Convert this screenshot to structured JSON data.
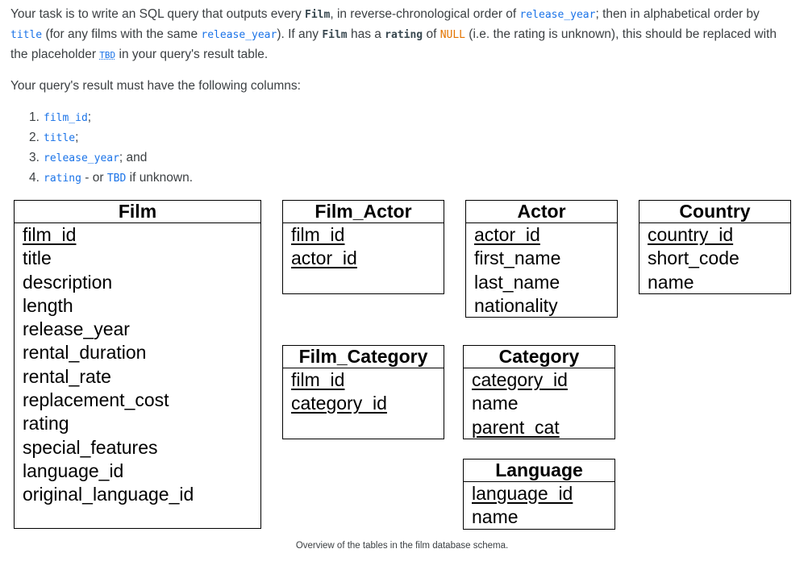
{
  "intro": {
    "t1": "Your task is to write an SQL query that outputs every ",
    "c1": "Film",
    "t2": ", in reverse-chronological order of ",
    "c2": "release_year",
    "t3": "; then in alphabetical order by ",
    "c3": "title",
    "t4": " (for any films with the same ",
    "c4": "release_year",
    "t5": "). If any ",
    "c5": "Film",
    "t6": " has a ",
    "c6": "rating",
    "t7": " of ",
    "c7": "NULL",
    "t8": " (i.e. the rating is unknown), this should be replaced with the placeholder ",
    "c8": "TBD",
    "t9": " in your query's result table."
  },
  "requirement": "Your query's result must have the following columns:",
  "columns": [
    {
      "num": "1.",
      "code": "film_id",
      "suffix": ";"
    },
    {
      "num": "2.",
      "code": "title",
      "suffix": ";"
    },
    {
      "num": "3.",
      "code": "release_year",
      "suffix": "; and"
    },
    {
      "num": "4.",
      "code": "rating",
      "mid": " - or ",
      "code2": "TBD",
      "suffix": " if unknown."
    }
  ],
  "tables": {
    "film": {
      "name": "Film",
      "fields": [
        "film_id",
        "title",
        "description",
        "length",
        "release_year",
        "rental_duration",
        "rental_rate",
        "replacement_cost",
        "rating",
        "special_features",
        "language_id",
        "original_language_id"
      ]
    },
    "film_actor": {
      "name": "Film_Actor",
      "fields": [
        "film_id",
        "actor_id"
      ]
    },
    "actor": {
      "name": "Actor",
      "fields": [
        "actor_id",
        "first_name",
        "last_name",
        "nationality"
      ]
    },
    "country": {
      "name": "Country",
      "fields": [
        "country_id",
        "short_code",
        "name"
      ]
    },
    "film_category": {
      "name": "Film_Category",
      "fields": [
        "film_id",
        "category_id"
      ]
    },
    "category": {
      "name": "Category",
      "fields": [
        "category_id",
        "name",
        "parent_cat"
      ]
    },
    "language": {
      "name": "Language",
      "fields": [
        "language_id",
        "name"
      ]
    }
  },
  "caption": "Overview of the tables in the film database schema."
}
